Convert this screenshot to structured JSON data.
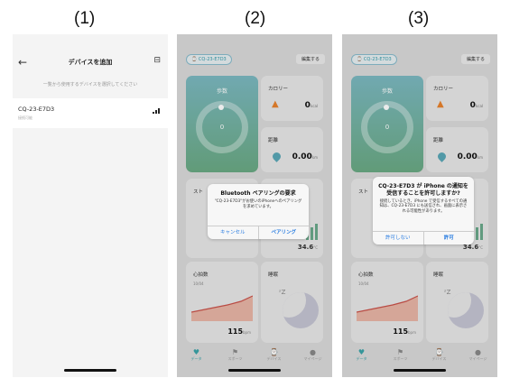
{
  "labels": [
    "(1)",
    "(2)",
    "(3)"
  ],
  "screen1": {
    "title": "デバイスを追加",
    "hint": "一覧から使用するデバイスを選択してください",
    "device_name": "CQ-23-E7D3",
    "device_status": "接続可能"
  },
  "app": {
    "device_chip": "CQ-23-E7D3",
    "edit": "編集する",
    "steps_label": "歩数",
    "steps_value": "0",
    "calorie_label": "カロリー",
    "calorie_value": "0",
    "calorie_unit": "kcal",
    "distance_label": "距離",
    "distance_value": "0.00",
    "distance_unit": "km",
    "sp_partial": "スト",
    "temp_value": "34.6",
    "temp_unit": "°C",
    "hr_label": "心拍数",
    "hr_date": "10/04",
    "hr_value": "115",
    "hr_unit": "bpm",
    "sleep_label": "睡眠",
    "tabs": [
      "データ",
      "スポーツ",
      "デバイス",
      "マイページ"
    ]
  },
  "dialog2": {
    "title": "Bluetooth ペアリングの要求",
    "body": "\"CQ-23-E7D3\"がお使いのiPhoneへのペアリングを求めています。",
    "cancel": "キャンセル",
    "pair": "ペアリング"
  },
  "dialog3": {
    "title": "CQ-23-E7D3 が iPhone の通知を受信することを許可しますか?",
    "body": "接続しているとき、iPhone で受信するすべての通知は、CQ-23-E7D3 にも送信され、画面に表示される可能性があります。",
    "deny": "許可しない",
    "allow": "許可"
  },
  "colors": {
    "accent": "#3aa3a8",
    "flame": "#e8822c",
    "link": "#2a7de1"
  }
}
